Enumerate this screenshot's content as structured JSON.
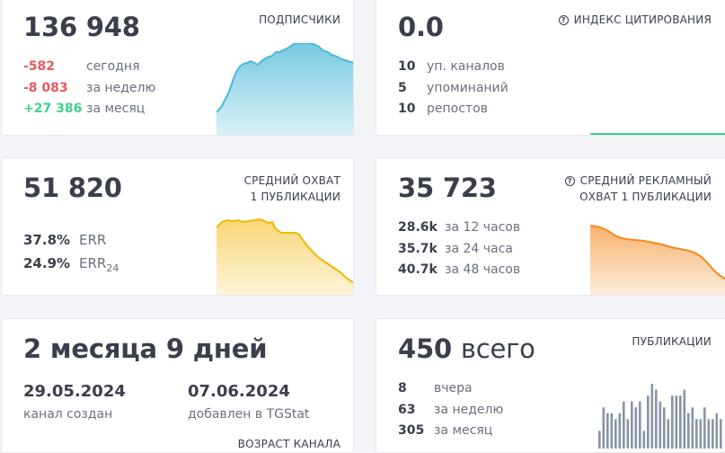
{
  "subscribers": {
    "value": "136 948",
    "label": "ПОДПИСЧИКИ",
    "rows": [
      {
        "value": "-582",
        "text": "сегодня"
      },
      {
        "value": "-8 083",
        "text": "за неделю"
      },
      {
        "value": "+27 386",
        "text": "за месяц"
      }
    ],
    "chart_color": "#4bb8d8"
  },
  "citation": {
    "value": "0.0",
    "label": "ИНДЕКС ЦИТИРОВАНИЯ",
    "info_icon": "question-circle-icon",
    "rows": [
      {
        "value": "10",
        "text": "уп. каналов"
      },
      {
        "value": "5",
        "text": "упоминаний"
      },
      {
        "value": "10",
        "text": "репостов"
      }
    ],
    "chart_color": "#3ecf8e"
  },
  "reach": {
    "value": "51 820",
    "label_line1": "СРЕДНИЙ ОХВАТ",
    "label_line2": "1 ПУБЛИКАЦИИ",
    "err": {
      "value": "37.8%",
      "text": "ERR"
    },
    "err24": {
      "value": "24.9%",
      "text": "ERR",
      "sub": "24"
    },
    "chart_color": "#f7c948"
  },
  "ad_reach": {
    "value": "35 723",
    "label_line1": "СРЕДНИЙ РЕКЛАМНЫЙ",
    "label_line2": "ОХВАТ 1 ПУБЛИКАЦИИ",
    "info_icon": "question-circle-icon",
    "rows": [
      {
        "value": "28.6k",
        "text": "за 12 часов"
      },
      {
        "value": "35.7k",
        "text": "за 24 часа"
      },
      {
        "value": "40.7k",
        "text": "за 48 часов"
      }
    ],
    "chart_color": "#f28a1e"
  },
  "age": {
    "value": "2 месяца 9 дней",
    "created_date": "29.05.2024",
    "created_text": "канал создан",
    "added_date": "07.06.2024",
    "added_text": "добавлен в TGStat",
    "label": "ВОЗРАСТ КАНАЛА"
  },
  "posts": {
    "value": "450",
    "unit": "всего",
    "label": "ПУБЛИКАЦИИ",
    "rows": [
      {
        "value": "8",
        "text": "вчера"
      },
      {
        "value": "63",
        "text": "за неделю"
      },
      {
        "value": "305",
        "text": "за месяц"
      }
    ],
    "chart_color": "#8a94a6",
    "chart_data": {
      "type": "bar",
      "values": [
        3,
        7,
        6,
        6,
        5,
        6,
        8,
        5,
        8,
        7,
        8,
        3,
        9,
        11,
        10,
        8,
        7,
        5,
        9,
        9,
        9,
        10,
        6,
        7,
        5,
        5,
        7,
        5,
        5,
        6,
        5
      ]
    }
  }
}
